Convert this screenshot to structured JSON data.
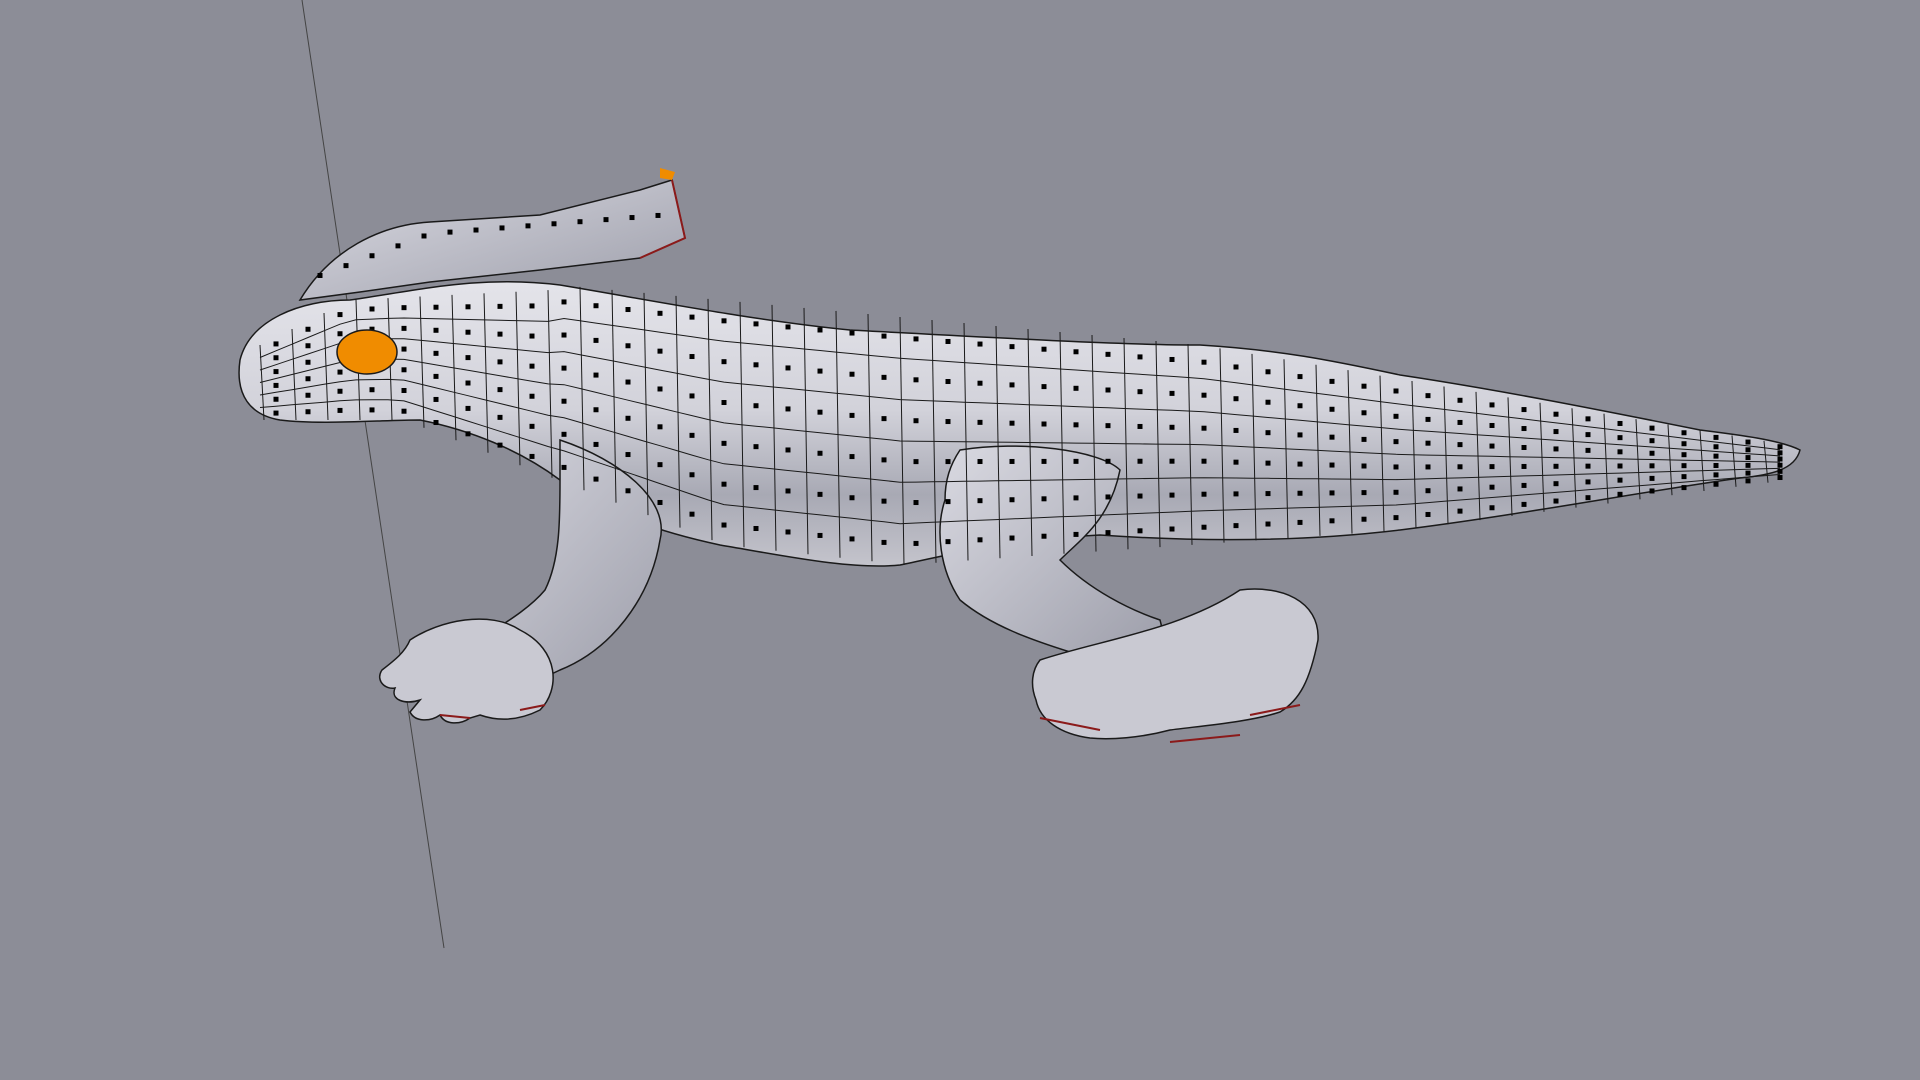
{
  "viewport": {
    "background": "#8c8d97",
    "mode": "edit-mode-vertex-select",
    "object": "lizard-mesh"
  },
  "mesh": {
    "base_color": "#d9d9e0",
    "shade_color": "#a9aab5",
    "edge_color": "#1a1a1a",
    "vertex_color": "#000000",
    "seam_color": "#8b1a1a",
    "selected_color": "#f08c00"
  }
}
